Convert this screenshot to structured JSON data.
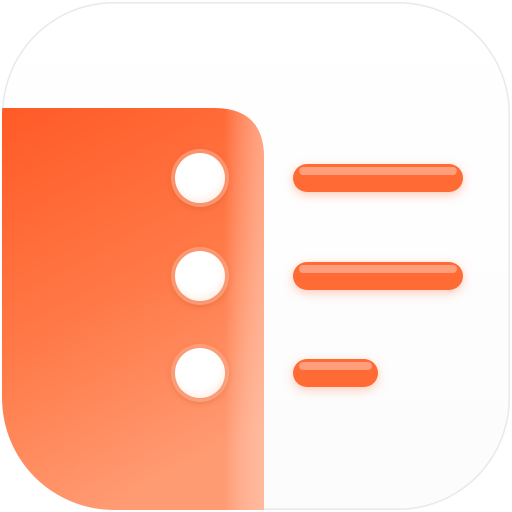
{
  "icon": {
    "name": "list-icon",
    "accent": "#ff6a35",
    "accent_light": "#ff9068",
    "line_color": "#ff6a35",
    "background": "#ffffff",
    "border": "#e9e9ec",
    "bullet_count": 3,
    "line_count": 3
  }
}
